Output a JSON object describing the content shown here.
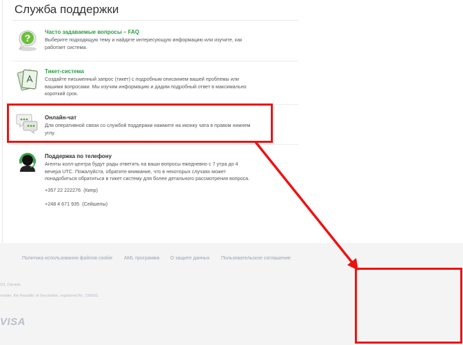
{
  "page_title": "Служба поддержки",
  "items": [
    {
      "title": "Часто задаваемые вопросы – FAQ",
      "description": "Выберите подходящую тему и найдите интересующую информацию или изучите, как работает система.",
      "icon": "faq-question-icon"
    },
    {
      "title": "Тикет-система",
      "description": "Создайте письменный запрос (тикет) с подробным описанием вашей проблемы или вашими вопросами. Мы изучим информацию и дадим подробный ответ в максимально короткий срок.",
      "icon": "ticket-icon"
    },
    {
      "title": "Онлайн-чат",
      "description": "Для оперативной связи со службой поддержки нажмите на иконку чата в правом нижнем углу.",
      "icon": "chat-icon"
    },
    {
      "title": "Поддержка по телефону",
      "description": "Агенты колл-центра будут рады ответить на ваши вопросы ежедневно с 7 утра до 4 вечера UTC. Пожалуйста, обратите внимание, что в некоторых случаях может понадобиться обратиться в тикет систему для более детального рассмотрения вопроса.",
      "icon": "headset-icon"
    }
  ],
  "phones": [
    {
      "number": "+357 22 222276",
      "label": "(Кипр)"
    },
    {
      "number": "+248 4 671 935",
      "label": "(Сейшелы)"
    }
  ],
  "footer": {
    "links": [
      "Политика использования файлов cookie",
      "AML программа",
      "О защите данных",
      "Пользовательское соглашение"
    ],
    "line1": "G3, Canada",
    "line2": "rovider, the Republic of Seychelles, registered No. 236692.",
    "payment_logo": "VISA"
  },
  "colors": {
    "accent_green": "#2a9b45",
    "highlight_red": "#ee1111",
    "footer_bg": "#f4f4f4"
  }
}
